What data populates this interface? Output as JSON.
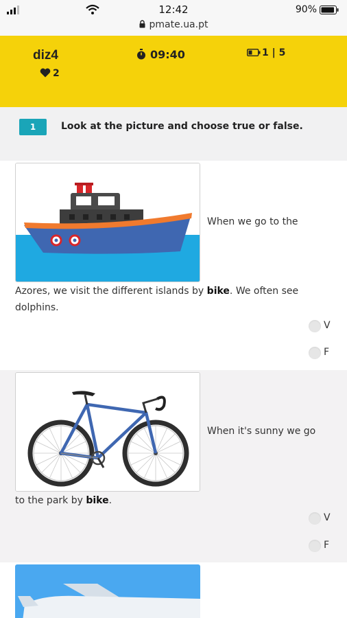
{
  "status_bar": {
    "time": "12:42",
    "battery_percent": "90%",
    "url": "pmate.ua.pt"
  },
  "header": {
    "username": "diz4",
    "lives": "2",
    "timer": "09:40",
    "progress": "1 | 5",
    "background_color": "#f5d20a"
  },
  "question": {
    "number": "1",
    "instruction": "Look at the picture and choose true or false.",
    "badge_color": "#1aa5b8"
  },
  "items": [
    {
      "image": "ship-illustration",
      "text_side": "When we go to the",
      "text_start": "Azores, we visit the different islands by ",
      "text_bold": "bike",
      "text_end": ". We often see dolphins.",
      "options": [
        "V",
        "F"
      ]
    },
    {
      "image": "bicycle-illustration",
      "text_side": "When it's sunny we go",
      "text_start": "to the park by ",
      "text_bold": "bike",
      "text_end": ".",
      "options": [
        "V",
        "F"
      ]
    },
    {
      "image": "airplane-illustration"
    }
  ]
}
